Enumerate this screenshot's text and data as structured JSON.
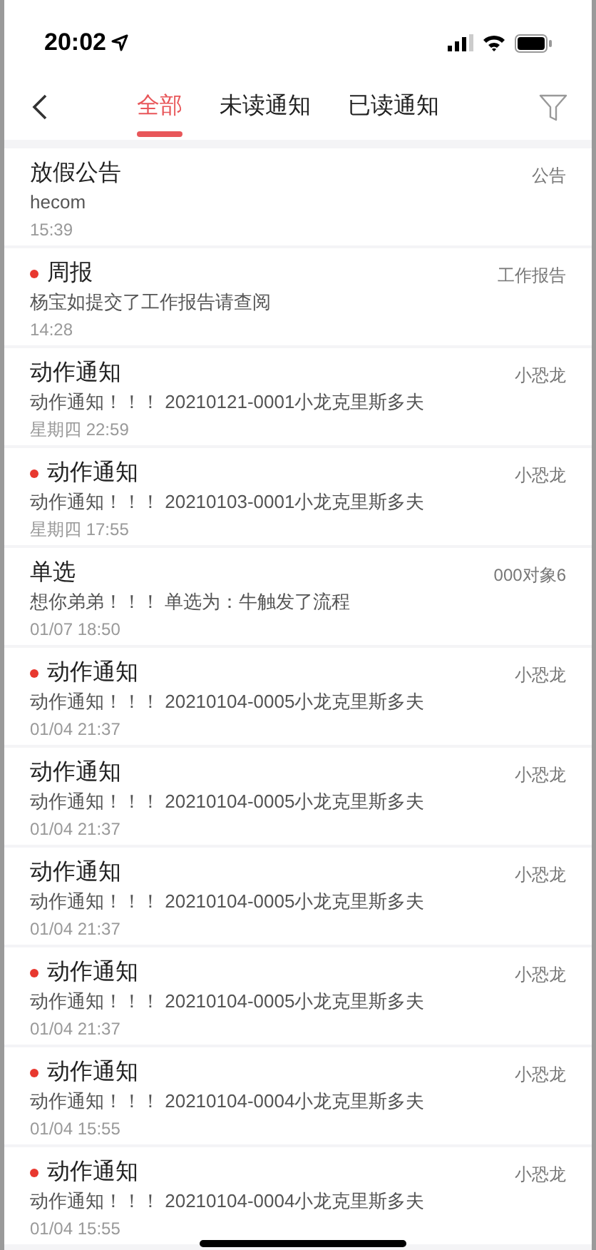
{
  "status_bar": {
    "time": "20:02"
  },
  "tabs": [
    {
      "label": "全部",
      "selected": true
    },
    {
      "label": "未读通知",
      "selected": false
    },
    {
      "label": "已读通知",
      "selected": false
    }
  ],
  "notifications": [
    {
      "title": "放假公告",
      "unread": false,
      "category": "公告",
      "body": "hecom",
      "time": "15:39"
    },
    {
      "title": "周报",
      "unread": true,
      "category": "工作报告",
      "body": "杨宝如提交了工作报告请查阅",
      "time": "14:28"
    },
    {
      "title": "动作通知",
      "unread": false,
      "category": "小恐龙",
      "body": "动作通知！！！ 20210121-0001小龙克里斯多夫",
      "time": "星期四 22:59"
    },
    {
      "title": "动作通知",
      "unread": true,
      "category": "小恐龙",
      "body": "动作通知！！！ 20210103-0001小龙克里斯多夫",
      "time": "星期四 17:55"
    },
    {
      "title": "单选",
      "unread": false,
      "category": "000对象6",
      "body": "想你弟弟！！！ 单选为：牛触发了流程",
      "time": "01/07 18:50"
    },
    {
      "title": "动作通知",
      "unread": true,
      "category": "小恐龙",
      "body": "动作通知！！！ 20210104-0005小龙克里斯多夫",
      "time": "01/04 21:37"
    },
    {
      "title": "动作通知",
      "unread": false,
      "category": "小恐龙",
      "body": "动作通知！！！ 20210104-0005小龙克里斯多夫",
      "time": "01/04 21:37"
    },
    {
      "title": "动作通知",
      "unread": false,
      "category": "小恐龙",
      "body": "动作通知！！！ 20210104-0005小龙克里斯多夫",
      "time": "01/04 21:37"
    },
    {
      "title": "动作通知",
      "unread": true,
      "category": "小恐龙",
      "body": "动作通知！！！ 20210104-0005小龙克里斯多夫",
      "time": "01/04 21:37"
    },
    {
      "title": "动作通知",
      "unread": true,
      "category": "小恐龙",
      "body": "动作通知！！！ 20210104-0004小龙克里斯多夫",
      "time": "01/04 15:55"
    },
    {
      "title": "动作通知",
      "unread": true,
      "category": "小恐龙",
      "body": "动作通知！！！ 20210104-0004小龙克里斯多夫",
      "time": "01/04 15:55"
    }
  ]
}
